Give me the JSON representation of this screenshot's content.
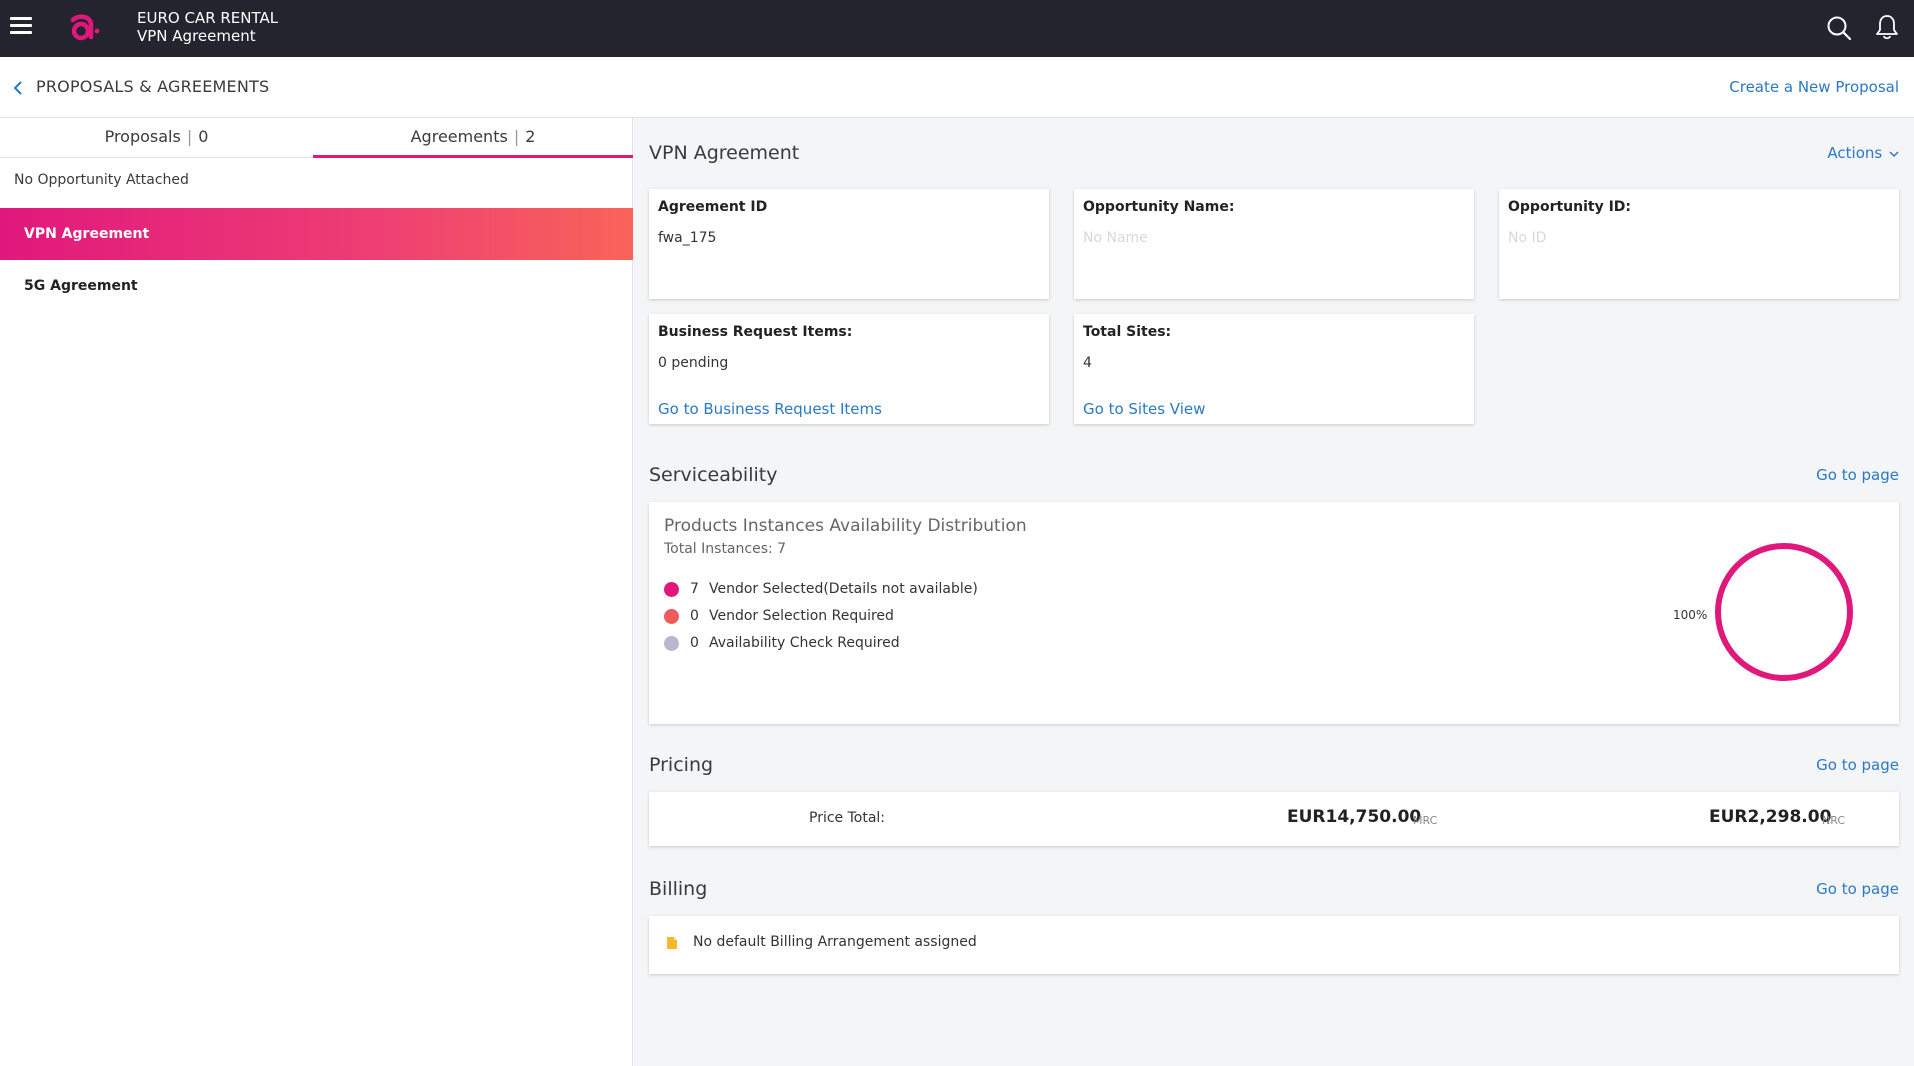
{
  "header": {
    "company": "EURO CAR RENTAL",
    "page": "VPN Agreement",
    "logo_icon": "amdocs-logo-icon",
    "accent": "#e0187c"
  },
  "breadcrumb": {
    "title": "PROPOSALS & AGREEMENTS",
    "create_link": "Create a New Proposal"
  },
  "left": {
    "tabs": [
      {
        "label": "Proposals",
        "count": "0"
      },
      {
        "label": "Agreements",
        "count": "2"
      }
    ],
    "active_tab": "Agreements",
    "no_opportunity": "No Opportunity Attached",
    "agreements": [
      "VPN Agreement",
      "5G Agreement"
    ]
  },
  "agreement": {
    "title": "VPN Agreement",
    "actions_label": "Actions",
    "cards": {
      "agreement_id": {
        "label": "Agreement ID",
        "value": "fwa_175"
      },
      "opportunity_name": {
        "label": "Opportunity Name:",
        "value": "No Name"
      },
      "opportunity_id": {
        "label": "Opportunity ID:",
        "value": "No ID"
      },
      "business_request": {
        "label": "Business Request Items:",
        "value": "0 pending",
        "link": "Go to Business Request Items"
      },
      "total_sites": {
        "label": "Total Sites:",
        "value": "4",
        "link": "Go to Sites View"
      }
    }
  },
  "serviceability": {
    "title": "Serviceability",
    "link": "Go to page",
    "chart_title": "Products Instances Availability Distribution",
    "total": "Total Instances: 7",
    "legend": [
      {
        "count": "7",
        "label": "Vendor Selected(Details not available)",
        "color": "#e0187c"
      },
      {
        "count": "0",
        "label": "Vendor Selection Required",
        "color": "#f05a5a"
      },
      {
        "count": "0",
        "label": "Availability Check Required",
        "color": "#b9b7cf"
      }
    ],
    "percent_label": "100%",
    "fraction": 1.0
  },
  "pricing": {
    "title": "Pricing",
    "link": "Go to page",
    "label": "Price Total:",
    "mrc": {
      "amount": "EUR14,750.00",
      "unit": "MRC"
    },
    "nrc": {
      "amount": "EUR2,298.00",
      "unit": "NRC"
    }
  },
  "billing": {
    "title": "Billing",
    "link": "Go to page",
    "message": "No default Billing Arrangement assigned",
    "icon": "document-warning-icon"
  }
}
